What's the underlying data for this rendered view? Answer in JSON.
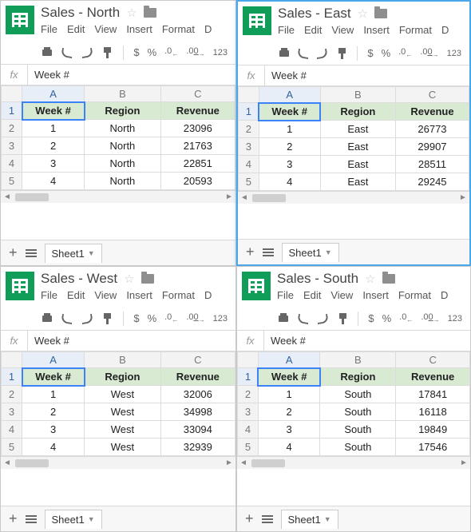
{
  "menus": [
    "File",
    "Edit",
    "View",
    "Insert",
    "Format",
    "D"
  ],
  "toolbar": {
    "dollar": "$",
    "percent": "%",
    "dec_dec": ".0←",
    "dec_inc": ".00→",
    "more": "123"
  },
  "sheet_tab_label": "Sheet1",
  "fx_label": "fx",
  "col_headers": [
    "A",
    "B",
    "C"
  ],
  "row_numbers": [
    "1",
    "2",
    "3",
    "4",
    "5"
  ],
  "table_headers": {
    "week": "Week #",
    "region": "Region",
    "revenue": "Revenue"
  },
  "formula_value": "Week #",
  "panes": [
    {
      "title": "Sales - North",
      "rows": [
        {
          "week": "1",
          "region": "North",
          "revenue": "23096"
        },
        {
          "week": "2",
          "region": "North",
          "revenue": "21763"
        },
        {
          "week": "3",
          "region": "North",
          "revenue": "22851"
        },
        {
          "week": "4",
          "region": "North",
          "revenue": "20593"
        }
      ]
    },
    {
      "title": "Sales - East",
      "rows": [
        {
          "week": "1",
          "region": "East",
          "revenue": "26773"
        },
        {
          "week": "2",
          "region": "East",
          "revenue": "29907"
        },
        {
          "week": "3",
          "region": "East",
          "revenue": "28511"
        },
        {
          "week": "4",
          "region": "East",
          "revenue": "29245"
        }
      ]
    },
    {
      "title": "Sales - West",
      "rows": [
        {
          "week": "1",
          "region": "West",
          "revenue": "32006"
        },
        {
          "week": "2",
          "region": "West",
          "revenue": "34998"
        },
        {
          "week": "3",
          "region": "West",
          "revenue": "33094"
        },
        {
          "week": "4",
          "region": "West",
          "revenue": "32939"
        }
      ]
    },
    {
      "title": "Sales - South",
      "rows": [
        {
          "week": "1",
          "region": "South",
          "revenue": "17841"
        },
        {
          "week": "2",
          "region": "South",
          "revenue": "16118"
        },
        {
          "week": "3",
          "region": "South",
          "revenue": "19849"
        },
        {
          "week": "4",
          "region": "South",
          "revenue": "17546"
        }
      ]
    }
  ],
  "chart_data": [
    {
      "type": "table",
      "title": "Sales - North",
      "columns": [
        "Week #",
        "Region",
        "Revenue"
      ],
      "rows": [
        [
          1,
          "North",
          23096
        ],
        [
          2,
          "North",
          21763
        ],
        [
          3,
          "North",
          22851
        ],
        [
          4,
          "North",
          20593
        ]
      ]
    },
    {
      "type": "table",
      "title": "Sales - East",
      "columns": [
        "Week #",
        "Region",
        "Revenue"
      ],
      "rows": [
        [
          1,
          "East",
          26773
        ],
        [
          2,
          "East",
          29907
        ],
        [
          3,
          "East",
          28511
        ],
        [
          4,
          "East",
          29245
        ]
      ]
    },
    {
      "type": "table",
      "title": "Sales - West",
      "columns": [
        "Week #",
        "Region",
        "Revenue"
      ],
      "rows": [
        [
          1,
          "West",
          32006
        ],
        [
          2,
          "West",
          34998
        ],
        [
          3,
          "West",
          33094
        ],
        [
          4,
          "West",
          32939
        ]
      ]
    },
    {
      "type": "table",
      "title": "Sales - South",
      "columns": [
        "Week #",
        "Region",
        "Revenue"
      ],
      "rows": [
        [
          1,
          "South",
          17841
        ],
        [
          2,
          "South",
          16118
        ],
        [
          3,
          "South",
          19849
        ],
        [
          4,
          "South",
          17546
        ]
      ]
    }
  ]
}
